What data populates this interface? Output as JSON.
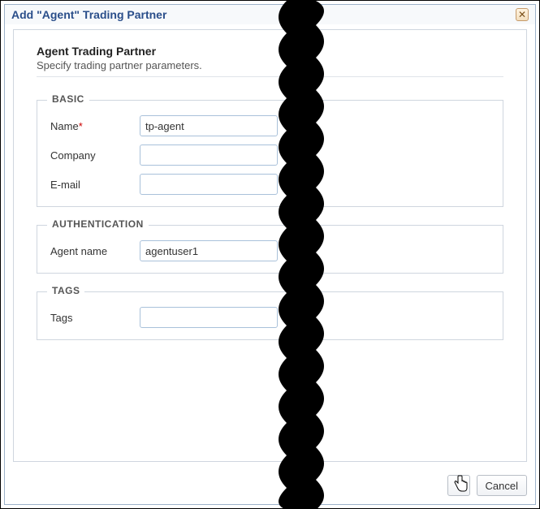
{
  "dialog": {
    "title": "Add \"Agent\" Trading Partner"
  },
  "header": {
    "title": "Agent Trading Partner",
    "subtitle": "Specify trading partner parameters."
  },
  "groups": {
    "basic": {
      "legend": "BASIC",
      "name_label": "Name",
      "name_required_mark": "*",
      "name_value": "tp-agent",
      "company_label": "Company",
      "company_value": "",
      "email_label": "E-mail",
      "email_value": ""
    },
    "auth": {
      "legend": "AUTHENTICATION",
      "agent_name_label": "Agent name",
      "agent_name_value": "agentuser1"
    },
    "tags": {
      "legend": "TAGS",
      "tags_label": "Tags",
      "tags_value": ""
    }
  },
  "footer": {
    "cancel_label": "Cancel"
  }
}
